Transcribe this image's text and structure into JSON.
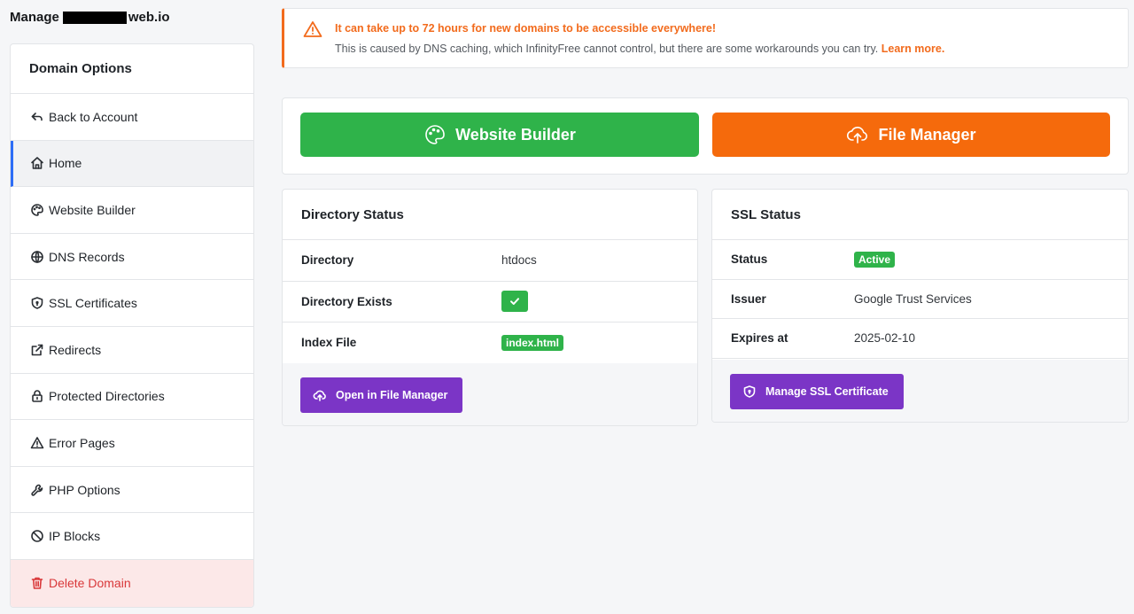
{
  "page_title": {
    "prefix": "Manage",
    "suffix": "web.io"
  },
  "sidebar": {
    "header": "Domain Options",
    "items": [
      {
        "label": "Back to Account",
        "icon": "back-arrow-icon"
      },
      {
        "label": "Home",
        "icon": "home-icon",
        "active": true
      },
      {
        "label": "Website Builder",
        "icon": "palette-icon"
      },
      {
        "label": "DNS Records",
        "icon": "globe-icon"
      },
      {
        "label": "SSL Certificates",
        "icon": "shield-icon"
      },
      {
        "label": "Redirects",
        "icon": "external-link-icon"
      },
      {
        "label": "Protected Directories",
        "icon": "lock-icon"
      },
      {
        "label": "Error Pages",
        "icon": "warning-icon"
      },
      {
        "label": "PHP Options",
        "icon": "wrench-icon"
      },
      {
        "label": "IP Blocks",
        "icon": "block-icon"
      },
      {
        "label": "Delete Domain",
        "icon": "trash-icon",
        "danger": true
      }
    ]
  },
  "alert": {
    "title": "It can take up to 72 hours for new domains to be accessible everywhere!",
    "body": "This is caused by DNS caching, which InfinityFree cannot control, but there are some workarounds you can try.",
    "link": "Learn more.",
    "color": "#f26b1d"
  },
  "quick_actions": {
    "website_builder": "Website Builder",
    "file_manager": "File Manager"
  },
  "directory_status": {
    "title": "Directory Status",
    "rows": [
      {
        "key": "Directory",
        "value": "htdocs"
      },
      {
        "key": "Directory Exists",
        "value": ""
      },
      {
        "key": "Index File",
        "value": "index.html"
      }
    ],
    "button": "Open in File Manager"
  },
  "ssl_status": {
    "title": "SSL Status",
    "rows": [
      {
        "key": "Status",
        "value": "Active"
      },
      {
        "key": "Issuer",
        "value": "Google Trust Services"
      },
      {
        "key": "Expires at",
        "value": "2025-02-10"
      }
    ],
    "button": "Manage SSL Certificate"
  },
  "colors": {
    "accent_green": "#2fb34a",
    "accent_orange": "#f56a0c",
    "accent_purple": "#7b35c6",
    "active_border": "#2d6df6",
    "danger": "#d9383a"
  }
}
